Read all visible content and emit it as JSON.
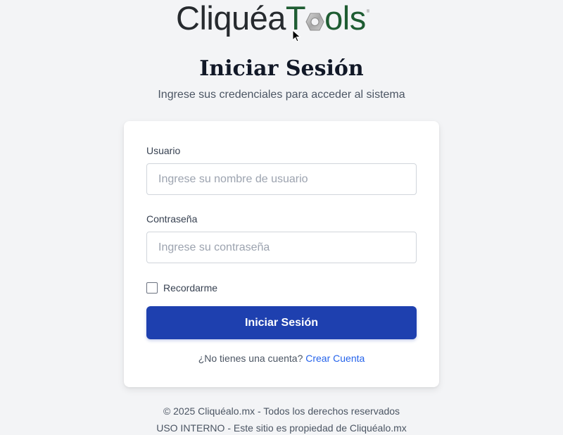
{
  "logo": {
    "part1": "Cliquéa",
    "part2": "T",
    "part3": "ols",
    "reg": "®"
  },
  "login": {
    "title": "Iniciar Sesión",
    "subtitle": "Ingrese sus credenciales para acceder al sistema",
    "username_label": "Usuario",
    "username_placeholder": "Ingrese su nombre de usuario",
    "username_value": "",
    "password_label": "Contraseña",
    "password_placeholder": "Ingrese su contraseña",
    "password_value": "",
    "remember_label": "Recordarme",
    "remember_checked": false,
    "submit_label": "Iniciar Sesión",
    "no_account_text": "¿No tienes una cuenta? ",
    "create_account_link": "Crear Cuenta"
  },
  "footer": {
    "copyright": "© 2025 Cliquéalo.mx - Todos los derechos reservados",
    "notice": "USO INTERNO - Este sitio es propiedad de Cliquéalo.mx"
  },
  "colors": {
    "background": "#f3f4f6",
    "primary_button": "#1e40af",
    "link": "#2563eb",
    "logo_dark": "#262a2e",
    "logo_green": "#1e5c32"
  },
  "icons": {
    "logo_nut": "hex-nut-icon",
    "cursor": "mouse-pointer-icon"
  }
}
